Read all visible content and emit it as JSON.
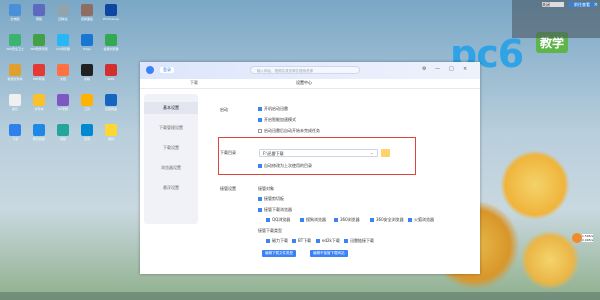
{
  "desktop": {
    "icons": [
      {
        "label": "此电脑"
      },
      {
        "label": "360安全卫士"
      },
      {
        "label": "新建文件夹"
      },
      {
        "label": "备忘"
      },
      {
        "label": "飞书"
      },
      {
        "label": "网络"
      },
      {
        "label": "360软件管家"
      },
      {
        "label": "PDF转换"
      },
      {
        "label": "文件夹"
      },
      {
        "label": "腾讯视频"
      },
      {
        "label": "回收站"
      },
      {
        "label": "QQ浏览器"
      },
      {
        "label": "文档"
      },
      {
        "label": "EV录屏"
      },
      {
        "label": "视频"
      },
      {
        "label": "控制面板"
      },
      {
        "label": "Edge"
      },
      {
        "label": "剪映"
      },
      {
        "label": "工具"
      },
      {
        "label": "迅雷"
      },
      {
        "label": "Photoshop"
      },
      {
        "label": "谷歌浏览器"
      },
      {
        "label": "WPS"
      },
      {
        "label": "百度网盘"
      },
      {
        "label": "素材"
      }
    ]
  },
  "watermark": {
    "brand": "pc6",
    "badge": "教学"
  },
  "notification": {
    "btn_close": "关闭",
    "btn_go": "前往查看",
    "close_glyph": "×"
  },
  "app": {
    "login_label": "登录",
    "search_placeholder": "输入网址、视频名或资源名搜索资源",
    "window_controls": [
      "⚙",
      "—",
      "□",
      "×"
    ],
    "tabs": [
      {
        "label": "下载"
      },
      {
        "label": "设置中心"
      }
    ],
    "nav": [
      {
        "label": "基本设置",
        "active": true
      },
      {
        "label": "下载管理设置",
        "active": false
      },
      {
        "label": "下载设置",
        "active": false
      },
      {
        "label": "浏览器设置",
        "active": false
      },
      {
        "label": "悬浮设置",
        "active": false
      }
    ],
    "startup": {
      "section": "启动",
      "options": [
        {
          "label": "开机启动迅雷",
          "checked": true
        },
        {
          "label": "开启智能加速模式",
          "checked": true
        },
        {
          "label": "启动迅雷后自动开始未完成任务",
          "checked": false
        }
      ]
    },
    "download_dir": {
      "section": "下载目录",
      "value": "F:\\迅雷下载",
      "remember_label": "自动修改为上次使用的目录",
      "remember_checked": true
    },
    "takeover": {
      "section": "接管设置",
      "target_label": "接管对象",
      "options": [
        {
          "label": "接管剪切板",
          "checked": true
        },
        {
          "label": "接管下载浏览器",
          "checked": true
        }
      ],
      "browsers": [
        {
          "label": "QQ浏览器",
          "checked": true
        },
        {
          "label": "搜狗浏览器",
          "checked": true
        },
        {
          "label": "360浏览器",
          "checked": true
        },
        {
          "label": "360安全浏览器",
          "checked": true
        },
        {
          "label": "火狐浏览器",
          "checked": true
        }
      ],
      "types_label": "接管下载类型",
      "types": [
        {
          "label": "磁力下载",
          "checked": true
        },
        {
          "label": "BT下载",
          "checked": true
        },
        {
          "label": "ed2k下载",
          "checked": true
        },
        {
          "label": "迅雷链接下载",
          "checked": true
        }
      ],
      "btn_file_types": "编辑下载文件类型",
      "btn_exclude": "编辑不接管下载网站"
    }
  },
  "floating_widget": {
    "line1": "1.5kB/s",
    "line2": "0.0kB/s"
  }
}
